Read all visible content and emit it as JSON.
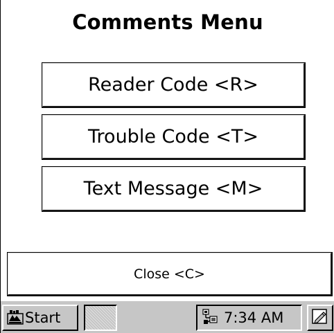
{
  "dialog": {
    "title": "Comments Menu"
  },
  "menu": {
    "items": [
      {
        "label": "Reader Code <R>"
      },
      {
        "label": "Trouble Code <T>"
      },
      {
        "label": "Text Message <M>"
      }
    ]
  },
  "close_button": {
    "label": "Close <C>"
  },
  "taskbar": {
    "start_label": "Start",
    "clock": "7:34 AM",
    "icons": {
      "start": "windows-flag-icon",
      "tray": "network-connection-icon",
      "desktop": "pencil-icon"
    }
  }
}
